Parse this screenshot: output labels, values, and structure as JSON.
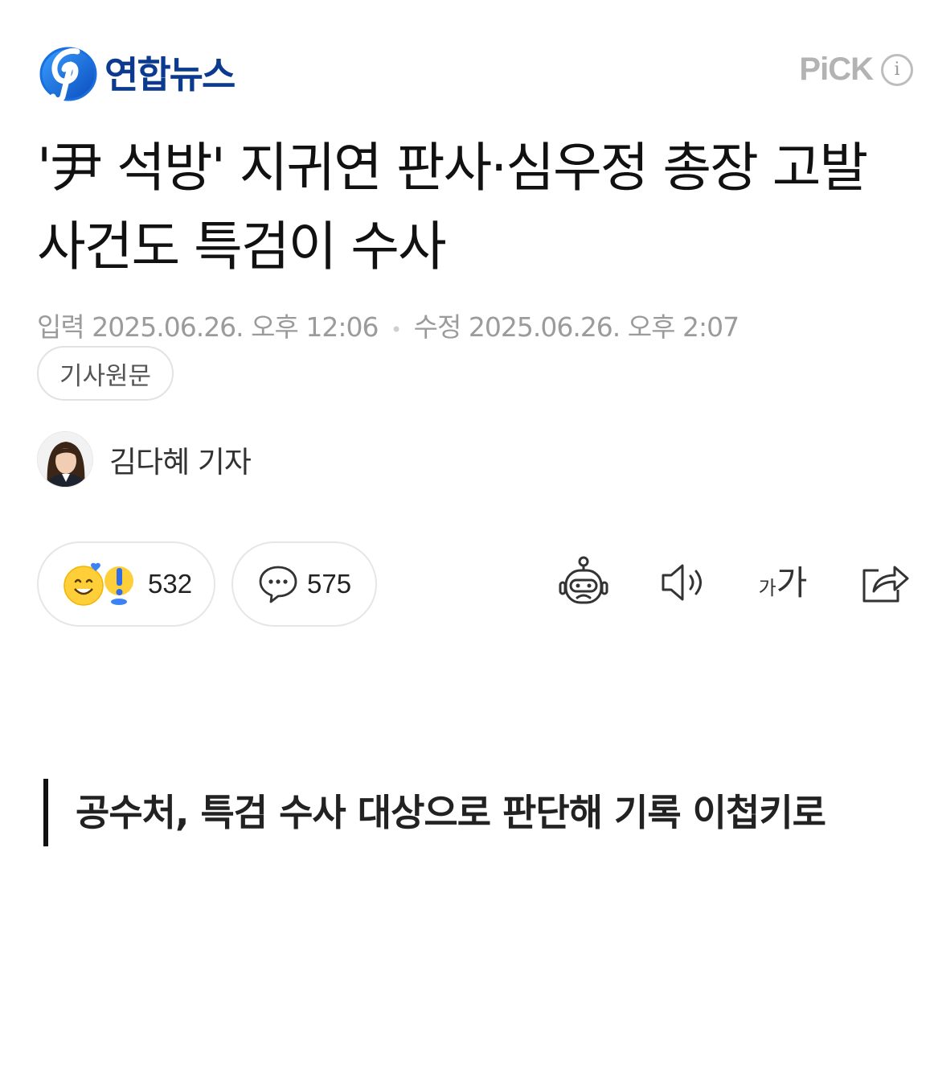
{
  "header": {
    "logo_text": "연합뉴스",
    "pick_label": "PiCK",
    "info_glyph": "i",
    "brand_color": "#0b3a8f"
  },
  "article": {
    "headline": "'尹 석방' 지귀연 판사·심우정 총장 고발 사건도 특검이 수사",
    "input_label": "입력",
    "input_date": "2025.06.26. 오후 12:06",
    "edit_label": "수정",
    "edit_date": "2025.06.26. 오후 2:07",
    "source_button": "기사원문",
    "reporter": "김다혜 기자",
    "subhead": "공수처, 특검 수사 대상으로 판단해 기록 이첩키로"
  },
  "actions": {
    "reaction_count": "532",
    "comment_count": "575",
    "font_small": "가",
    "font_large": "가",
    "icons": [
      "summary-bot-icon",
      "speaker-icon",
      "font-size-icon",
      "share-icon"
    ]
  }
}
